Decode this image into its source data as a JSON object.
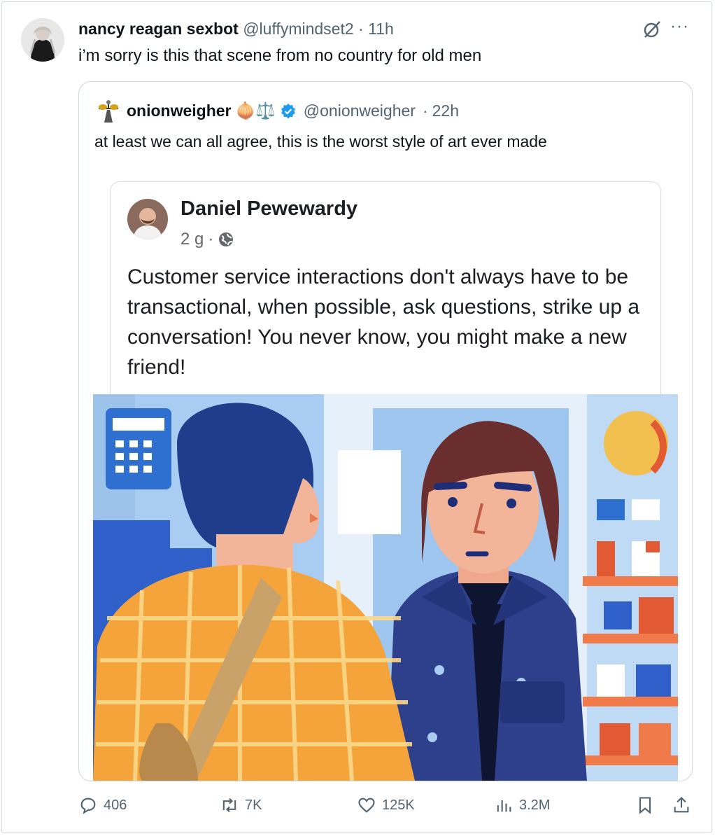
{
  "tweet": {
    "display_name": "nancy reagan sexbot",
    "handle": "@luffymindset2",
    "time": "11h",
    "text": "i’m sorry is this that scene from no country for old men"
  },
  "quote": {
    "display_name": "onionweigher",
    "emoji": "🧅⚖️",
    "handle": "@onionweigher",
    "time": "22h",
    "text": "at least we can all agree, this is the worst style of art ever made"
  },
  "fb_post": {
    "author": "Daniel Pewewardy",
    "age": "2 g",
    "body": "Customer service interactions don't always have to be transactional, when possible, ask questions, strike up a conversation! You never know, you might make a new friend!"
  },
  "actions": {
    "replies": "406",
    "reposts": "7K",
    "likes": "125K",
    "views": "3.2M"
  },
  "icons": {
    "more": "more-icon",
    "grok": "grok-icon",
    "verified": "verified-badge-icon",
    "globe": "globe-icon",
    "reply": "reply-icon",
    "repost": "repost-icon",
    "like": "like-icon",
    "views": "views-icon",
    "bookmark": "bookmark-icon",
    "share": "share-icon"
  },
  "colors": {
    "verified": "#1d9bf0",
    "muted": "#536471"
  }
}
